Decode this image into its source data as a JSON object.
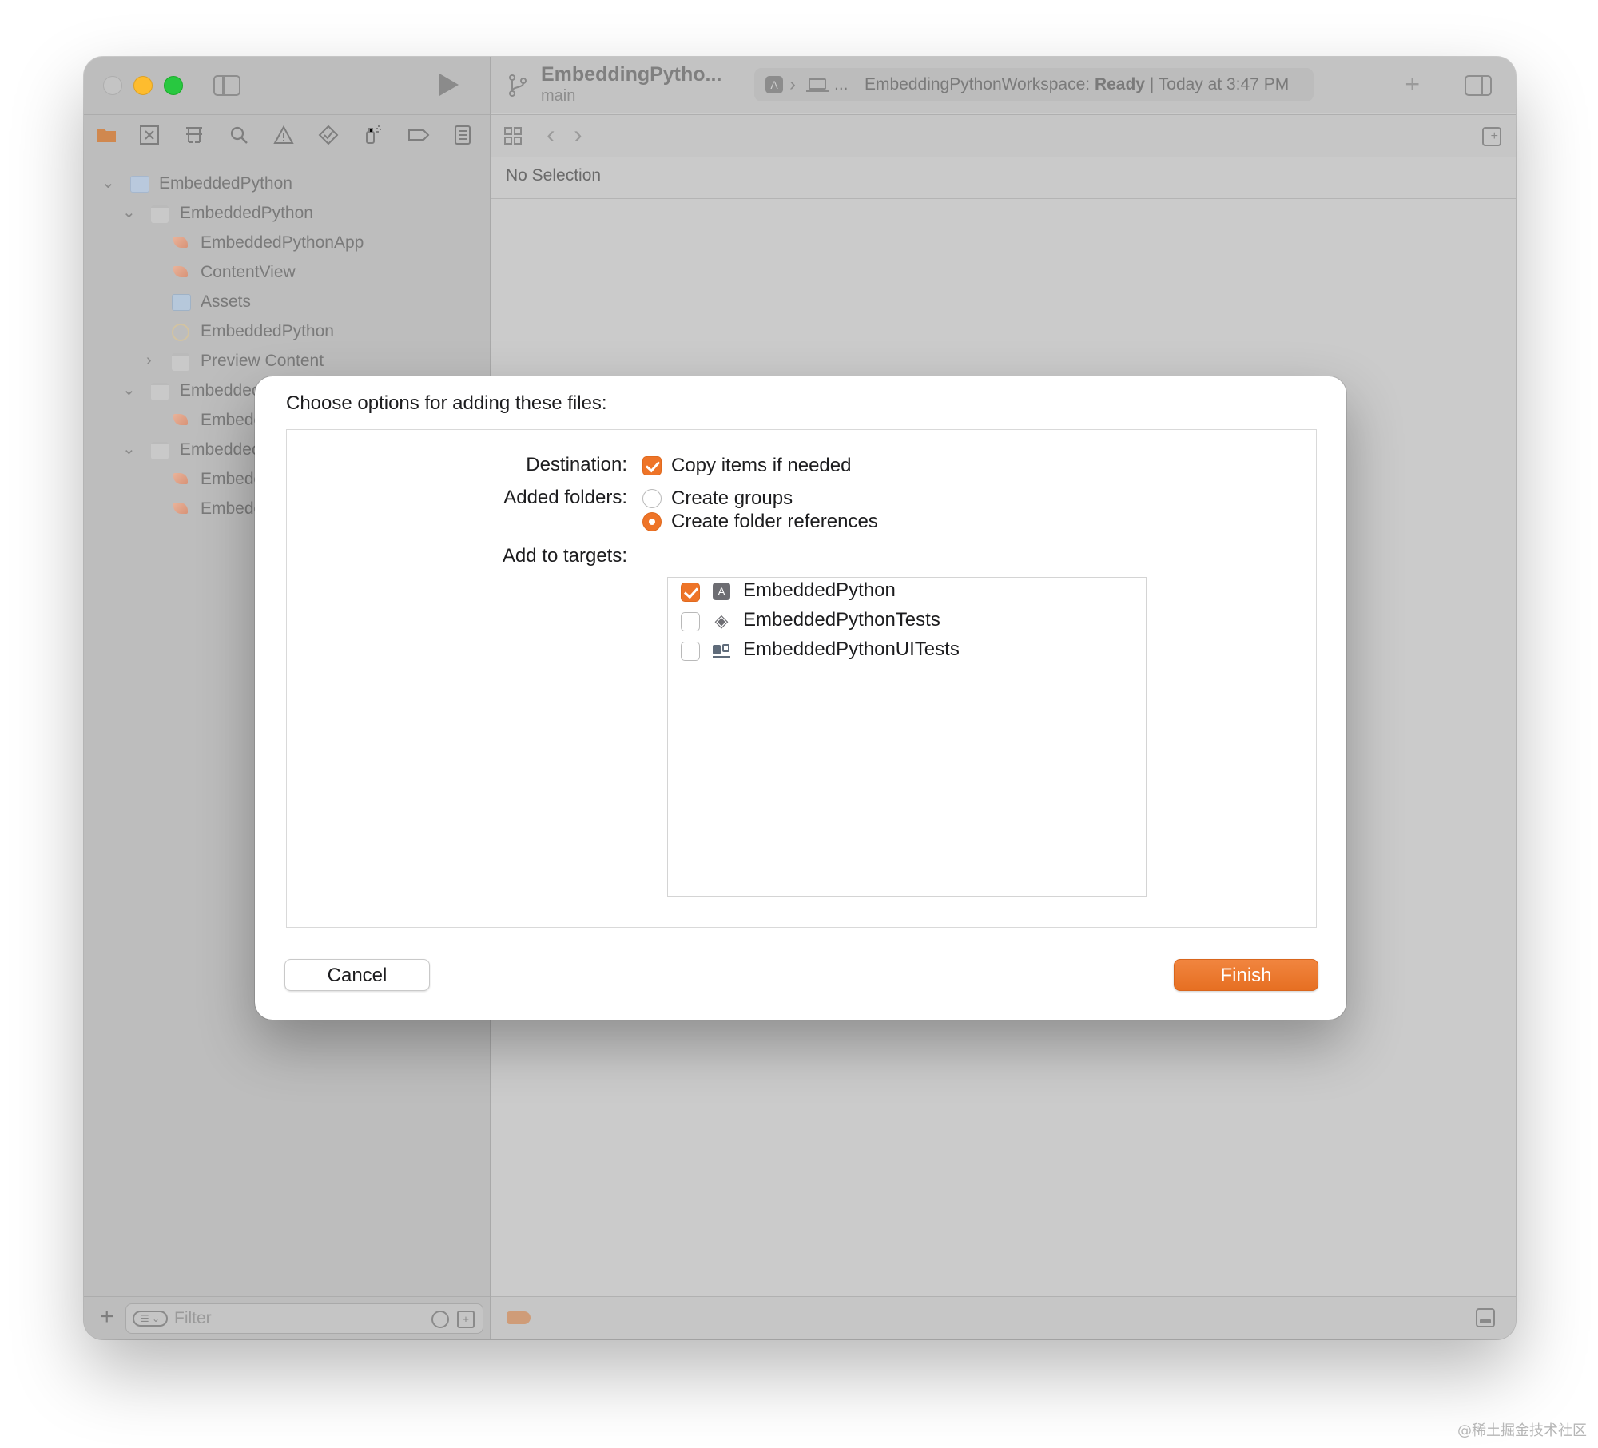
{
  "workspace": {
    "scheme_name": "EmbeddingPytho...",
    "branch": "main",
    "activity": {
      "dots": "...",
      "workspace_name": "EmbeddingPythonWorkspace:",
      "status": "Ready",
      "separator": "|",
      "time": "Today at 3:47 PM"
    },
    "jump_bar": "No Selection",
    "filter_placeholder": "Filter"
  },
  "navigator": {
    "tree": [
      {
        "label": "EmbeddedPython",
        "kind": "project",
        "expanded": true
      },
      {
        "label": "EmbeddedPython",
        "kind": "folder",
        "expanded": true
      },
      {
        "label": "EmbeddedPythonApp",
        "kind": "swift"
      },
      {
        "label": "ContentView",
        "kind": "swift"
      },
      {
        "label": "Assets",
        "kind": "assets"
      },
      {
        "label": "EmbeddedPython",
        "kind": "entitlements"
      },
      {
        "label": "Preview Content",
        "kind": "folder",
        "expanded": false
      },
      {
        "label": "Embeddec",
        "kind": "folder",
        "expanded": true
      },
      {
        "label": "Embedc",
        "kind": "swift"
      },
      {
        "label": "Embeddec",
        "kind": "folder",
        "expanded": true
      },
      {
        "label": "Embedc",
        "kind": "swift"
      },
      {
        "label": "Embedc",
        "kind": "swift"
      }
    ]
  },
  "dialog": {
    "title": "Choose options for adding these files:",
    "destination": {
      "label": "Destination:",
      "option": "Copy items if needed",
      "checked": true
    },
    "added_folders": {
      "label": "Added folders:",
      "options": [
        {
          "label": "Create groups",
          "selected": false
        },
        {
          "label": "Create folder references",
          "selected": true
        }
      ]
    },
    "targets": {
      "label": "Add to targets:",
      "items": [
        {
          "name": "EmbeddedPython",
          "checked": true,
          "icon": "app-target-icon"
        },
        {
          "name": "EmbeddedPythonTests",
          "checked": false,
          "icon": "unit-test-target-icon"
        },
        {
          "name": "EmbeddedPythonUITests",
          "checked": false,
          "icon": "ui-test-target-icon"
        }
      ]
    },
    "cancel_label": "Cancel",
    "finish_label": "Finish"
  },
  "colors": {
    "accent": "#ee7428"
  },
  "watermark": "@稀土掘金技术社区"
}
